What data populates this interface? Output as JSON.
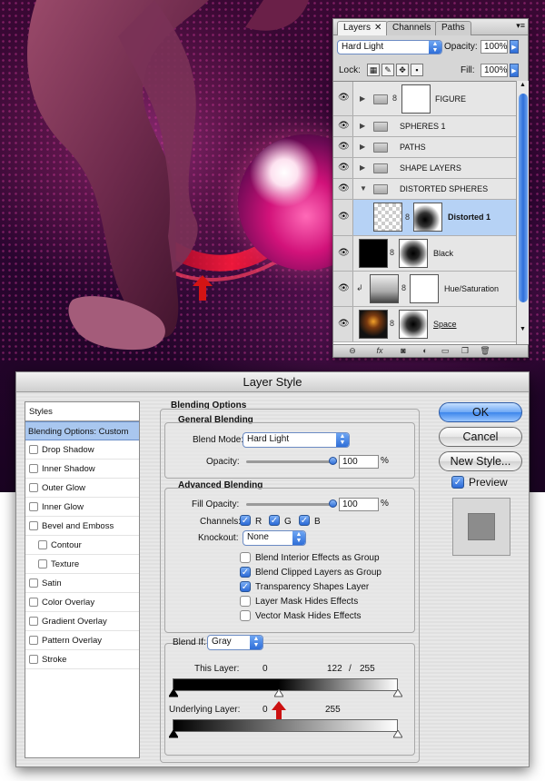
{
  "artwork": {
    "accent": "#e0117c",
    "background": "#2a0530"
  },
  "layers_panel": {
    "tabs": [
      {
        "label": "Layers",
        "close": "✕"
      },
      {
        "label": "Channels"
      },
      {
        "label": "Paths"
      }
    ],
    "blend_mode": "Hard Light",
    "opacity_label": "Opacity:",
    "opacity_value": "100%",
    "lock_label": "Lock:",
    "fill_label": "Fill:",
    "fill_value": "100%",
    "layers": [
      {
        "name": "FIGURE",
        "kind": "group-with-mask"
      },
      {
        "name": "SPHERES 1",
        "kind": "group"
      },
      {
        "name": "PATHS",
        "kind": "group"
      },
      {
        "name": "SHAPE LAYERS",
        "kind": "group"
      },
      {
        "name": "DISTORTED SPHERES",
        "kind": "group-open"
      },
      {
        "name": "Distorted 1",
        "kind": "layer",
        "selected": true
      },
      {
        "name": "Black",
        "kind": "layer"
      },
      {
        "name": "Hue/Saturation",
        "kind": "adjustment"
      },
      {
        "name": "Space",
        "kind": "layer"
      }
    ]
  },
  "dialog": {
    "title": "Layer Style",
    "styles_header": "Styles",
    "styles": [
      {
        "label": "Blending Options: Custom",
        "selected": true
      },
      {
        "label": "Drop Shadow"
      },
      {
        "label": "Inner Shadow"
      },
      {
        "label": "Outer Glow"
      },
      {
        "label": "Inner Glow"
      },
      {
        "label": "Bevel and Emboss"
      },
      {
        "label": "Contour",
        "indent": true
      },
      {
        "label": "Texture",
        "indent": true
      },
      {
        "label": "Satin"
      },
      {
        "label": "Color Overlay"
      },
      {
        "label": "Gradient Overlay"
      },
      {
        "label": "Pattern Overlay"
      },
      {
        "label": "Stroke"
      }
    ],
    "blending_options_title": "Blending Options",
    "general_blending_title": "General Blending",
    "blend_mode_label": "Blend Mode:",
    "blend_mode_value": "Hard Light",
    "opacity_label": "Opacity:",
    "opacity_value": "100",
    "opacity_fraction": 1.0,
    "percent": "%",
    "advanced_blending_title": "Advanced Blending",
    "fill_opacity_label": "Fill Opacity:",
    "fill_opacity_value": "100",
    "fill_opacity_fraction": 1.0,
    "channels_label": "Channels:",
    "channel_r": "R",
    "channel_g": "G",
    "channel_b": "B",
    "knockout_label": "Knockout:",
    "knockout_value": "None",
    "options": [
      {
        "label": "Blend Interior Effects as Group",
        "checked": false
      },
      {
        "label": "Blend Clipped Layers as Group",
        "checked": true
      },
      {
        "label": "Transparency Shapes Layer",
        "checked": true
      },
      {
        "label": "Layer Mask Hides Effects",
        "checked": false
      },
      {
        "label": "Vector Mask Hides Effects",
        "checked": false
      }
    ],
    "blend_if_label": "Blend If:",
    "blend_if_value": "Gray",
    "this_layer_label": "This Layer:",
    "this_layer_low": "0",
    "this_layer_mid": "122",
    "this_layer_sep": "/",
    "this_layer_high": "255",
    "underlying_layer_label": "Underlying Layer:",
    "underlying_low": "0",
    "underlying_high": "255",
    "ok_label": "OK",
    "cancel_label": "Cancel",
    "new_style_label": "New Style...",
    "preview_label": "Preview",
    "preview_checked": true,
    "highlight_arrow_color": "#cc1111"
  }
}
